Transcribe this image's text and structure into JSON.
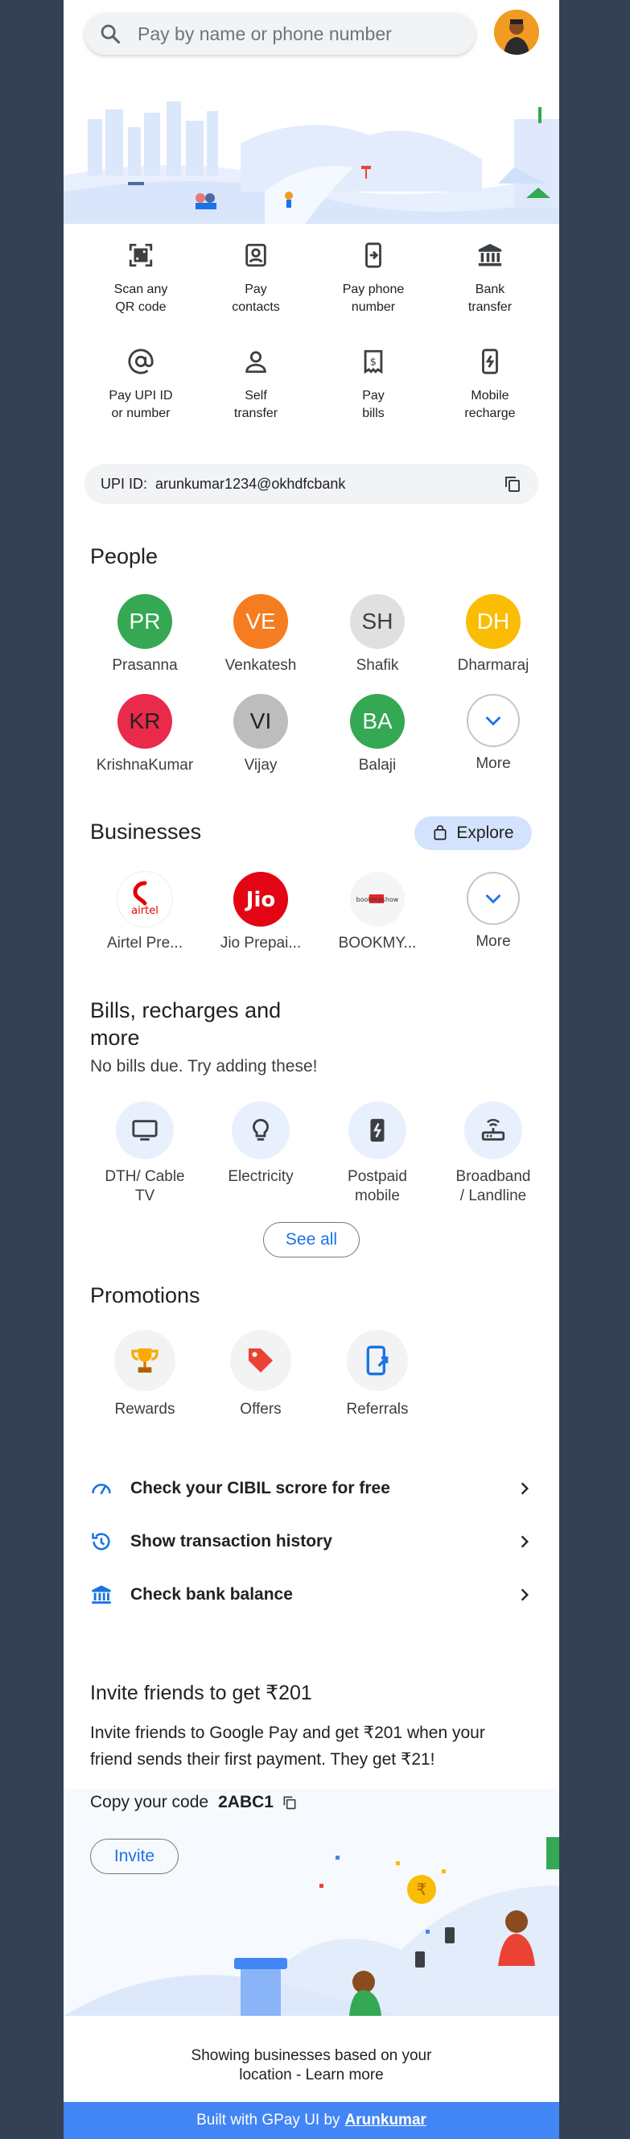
{
  "search": {
    "placeholder": "Pay by name or phone number",
    "icon": "search-icon"
  },
  "quick_actions": [
    {
      "label": "Scan any\nQR code",
      "icon": "qr-scan-icon"
    },
    {
      "label": "Pay\ncontacts",
      "icon": "contact-icon"
    },
    {
      "label": "Pay phone\nnumber",
      "icon": "phone-pay-icon"
    },
    {
      "label": "Bank\ntransfer",
      "icon": "bank-icon"
    },
    {
      "label": "Pay UPI ID\nor number",
      "icon": "at-sign-icon"
    },
    {
      "label": "Self\ntransfer",
      "icon": "person-icon"
    },
    {
      "label": "Pay\nbills",
      "icon": "bill-icon"
    },
    {
      "label": "Mobile\nrecharge",
      "icon": "mobile-recharge-icon"
    }
  ],
  "upi": {
    "label": "UPI ID:",
    "value": "arunkumar1234@okhdfcbank"
  },
  "people": {
    "title": "People",
    "items": [
      {
        "initials": "PR",
        "name": "Prasanna",
        "color": "#34a853"
      },
      {
        "initials": "VE",
        "name": "Venkatesh",
        "color": "#f57c1f"
      },
      {
        "initials": "SH",
        "name": "Shafik",
        "color": "#e0e0e0"
      },
      {
        "initials": "DH",
        "name": "Dharmaraj",
        "color": "#fbbc04"
      },
      {
        "initials": "KR",
        "name": "KrishnaKumar",
        "color": "#ea2a4a"
      },
      {
        "initials": "VI",
        "name": "Vijay",
        "color": "#bdbdbd"
      },
      {
        "initials": "BA",
        "name": "Balaji",
        "color": "#34a853"
      }
    ],
    "more": "More"
  },
  "businesses": {
    "title": "Businesses",
    "explore": "Explore",
    "items": [
      {
        "name": "Airtel Pre...",
        "logo_text": "airtel"
      },
      {
        "name": "Jio Prepai...",
        "logo_text": "Jio"
      },
      {
        "name": "BOOKMY...",
        "logo_text": "bookmyshow"
      }
    ],
    "more": "More"
  },
  "bills": {
    "title": "Bills, recharges and more",
    "subtitle": "No bills due. Try adding these!",
    "items": [
      {
        "label": "DTH/ Cable\nTV",
        "icon": "tv-icon"
      },
      {
        "label": "Electricity",
        "icon": "bulb-icon"
      },
      {
        "label": "Postpaid\nmobile",
        "icon": "mobile-icon"
      },
      {
        "label": "Broadband\n/ Landline",
        "icon": "router-icon"
      }
    ],
    "see_all": "See all"
  },
  "promotions": {
    "title": "Promotions",
    "items": [
      {
        "label": "Rewards",
        "icon": "trophy-icon"
      },
      {
        "label": "Offers",
        "icon": "tag-icon"
      },
      {
        "label": "Referrals",
        "icon": "referral-icon"
      }
    ]
  },
  "links": [
    {
      "label": "Check your CIBIL scrore for free",
      "icon": "speedometer-icon"
    },
    {
      "label": "Show transaction history",
      "icon": "history-icon"
    },
    {
      "label": "Check bank balance",
      "icon": "bank-icon"
    }
  ],
  "invite": {
    "title": "Invite friends to get ₹201",
    "desc": "Invite friends to Google Pay and get ₹201 when your friend sends their first payment. They get ₹21!",
    "copy_label": "Copy your code",
    "code": "2ABC1",
    "button": "Invite"
  },
  "footer": {
    "note": "Showing businesses based on your\nlocation - Learn more",
    "built_text": "Built with GPay UI by",
    "author": "Arunkumar"
  },
  "colors": {
    "accent": "#1a73e8",
    "footer": "#4285f4",
    "background": "#344154"
  }
}
